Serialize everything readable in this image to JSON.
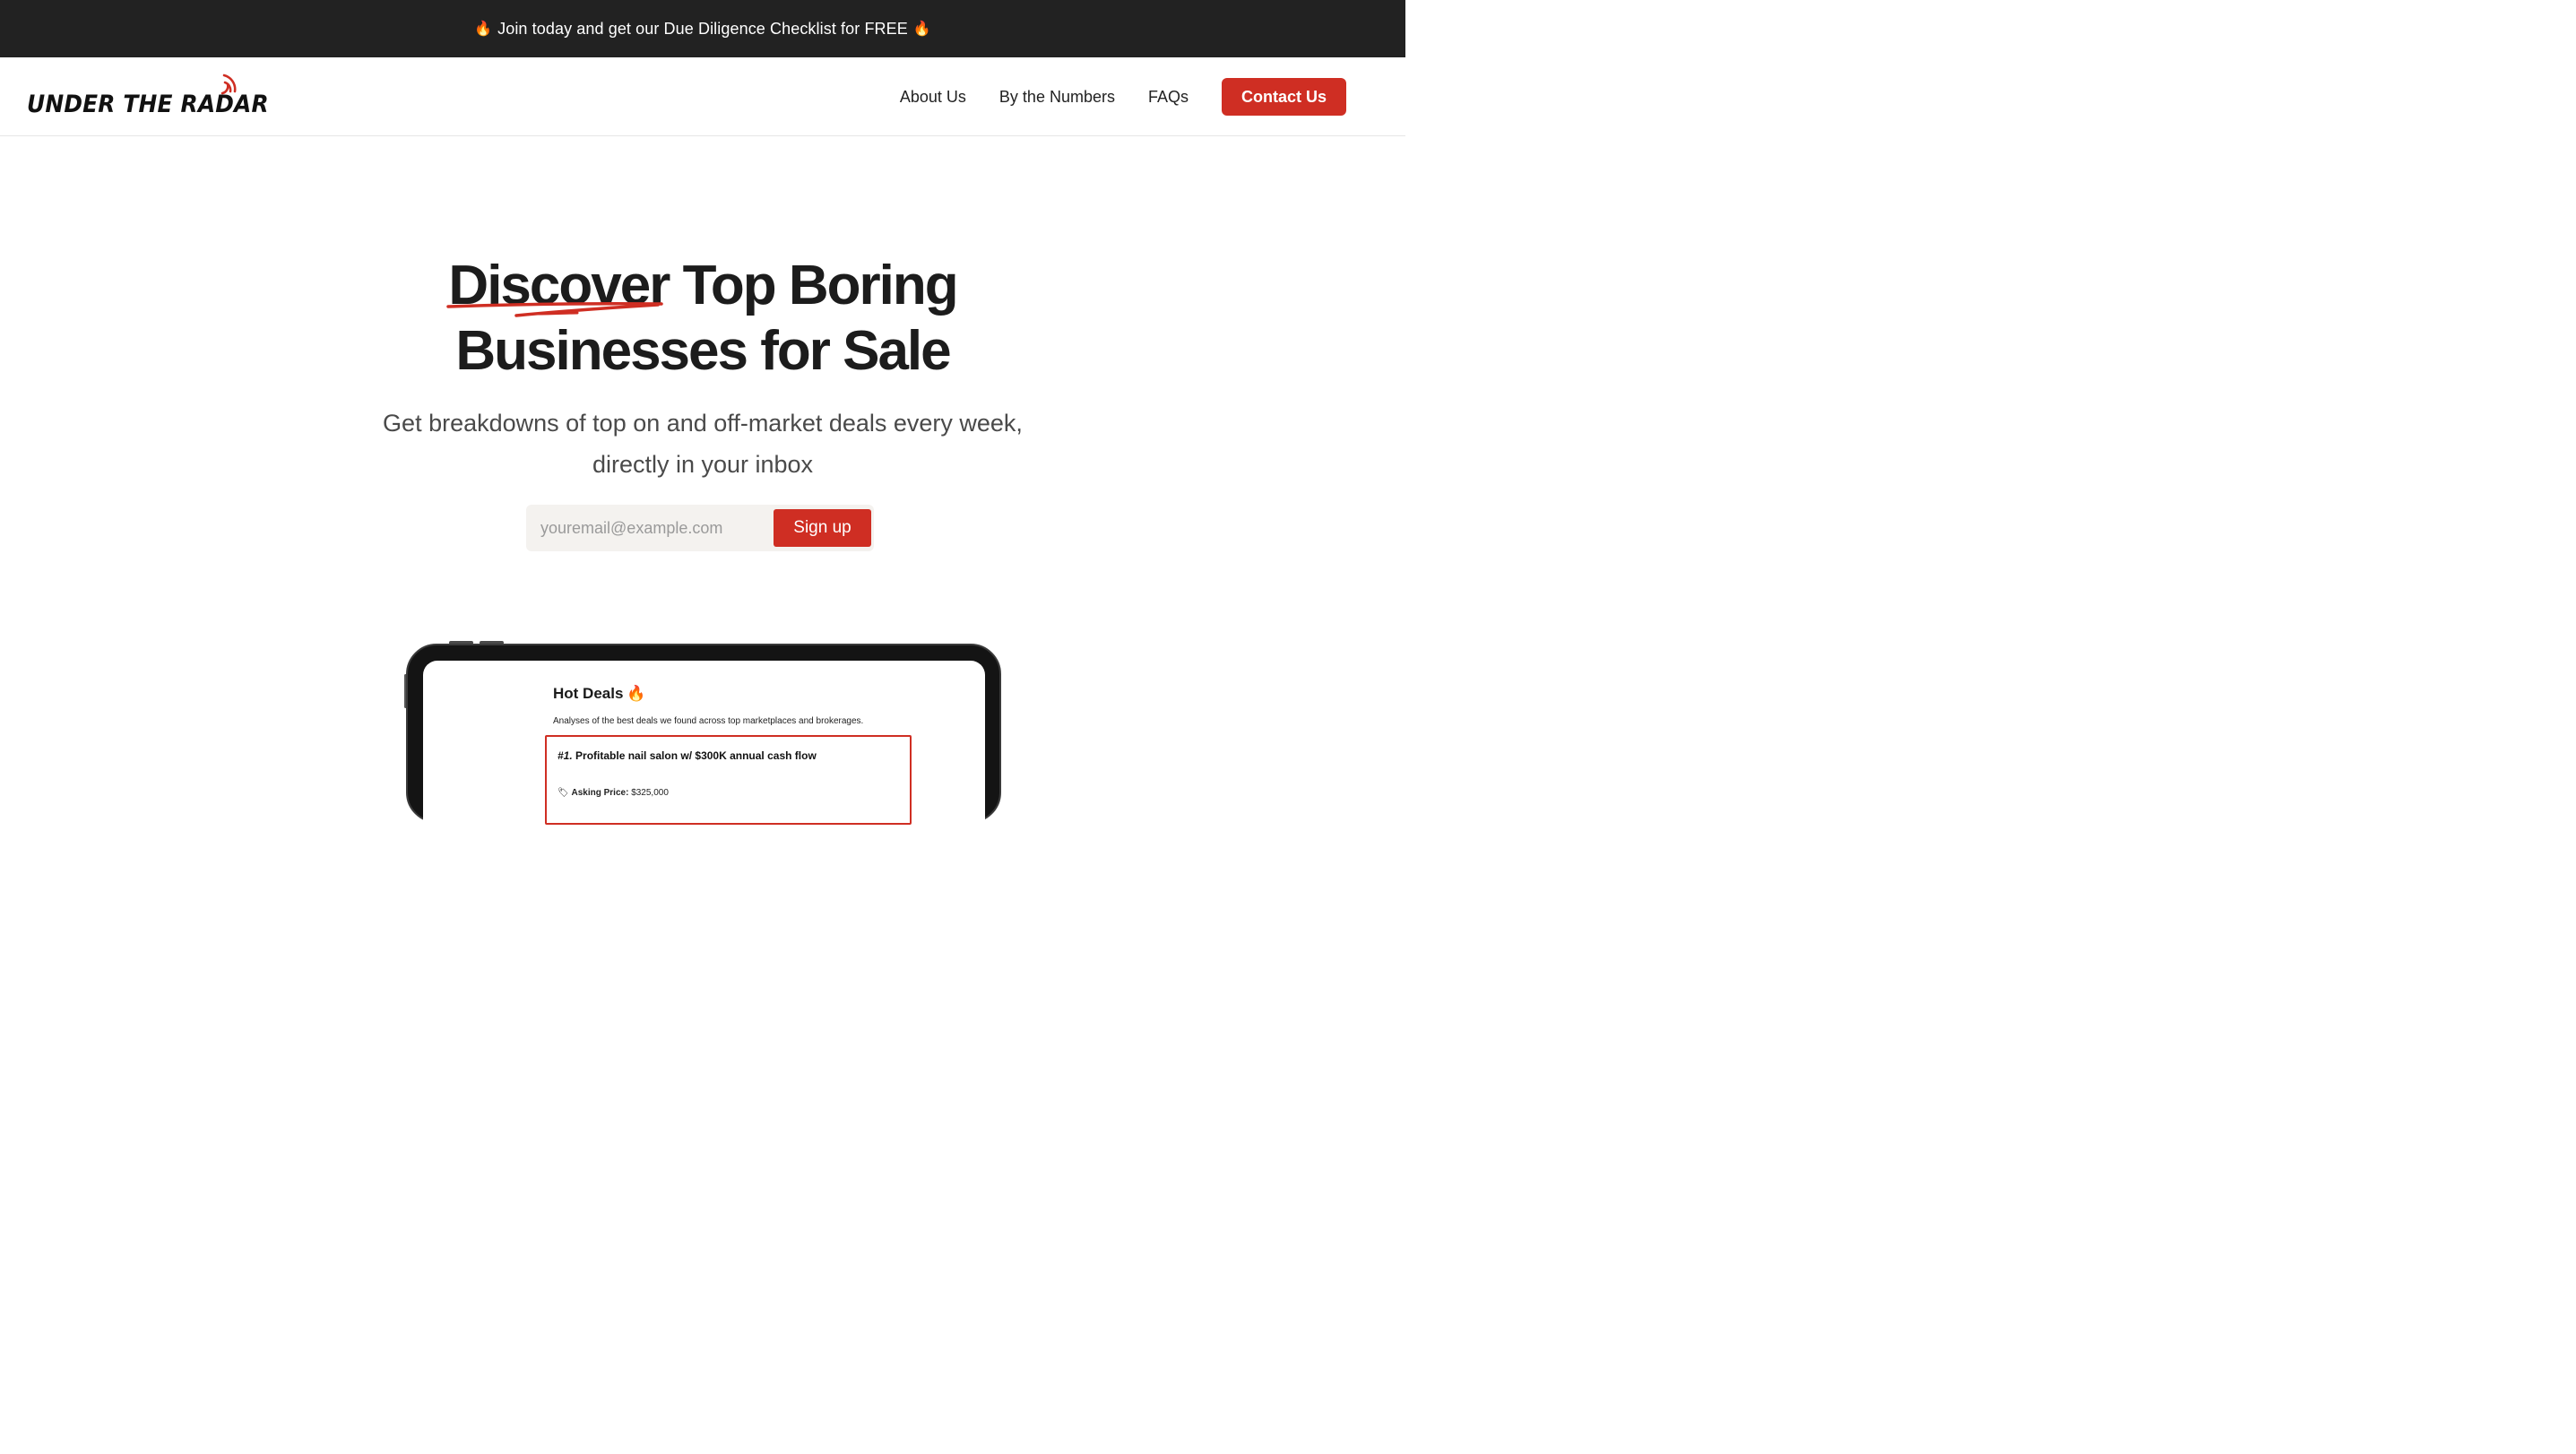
{
  "promo": {
    "text": "Join today and get our Due Diligence Checklist for FREE",
    "icon": "fire-icon"
  },
  "nav": {
    "logo_text": "UNDER THE RADAR",
    "links": [
      "About Us",
      "By the Numbers",
      "FAQs"
    ],
    "cta_label": "Contact Us"
  },
  "hero": {
    "title_highlight": "Discover",
    "title_rest_line1": " Top Boring",
    "title_line2": "Businesses for Sale",
    "subtitle_line1": "Get breakdowns of top on and off-market deals every week,",
    "subtitle_line2": "directly in your inbox"
  },
  "signup": {
    "placeholder": "youremail@example.com",
    "button_label": "Sign up"
  },
  "preview": {
    "title": "Hot Deals",
    "subtitle": "Analyses of the best deals we found across top marketplaces and brokerages.",
    "deal": {
      "rank": "#1.",
      "title": "Profitable nail salon w/ $300K annual cash flow",
      "price_label": "Asking Price:",
      "price_value": "$325,000"
    }
  },
  "colors": {
    "accent": "#cf2e23",
    "promo_bg": "#222222",
    "input_bg": "#f4f2ef"
  }
}
